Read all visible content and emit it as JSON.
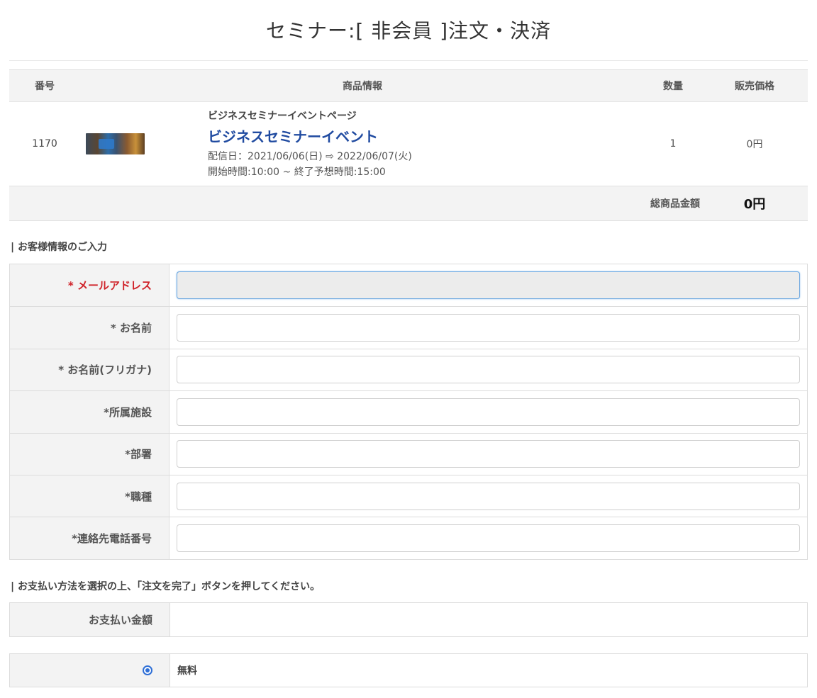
{
  "page": {
    "title": "セミナー:[ 非会員 ]注文・決済"
  },
  "order": {
    "headers": {
      "no": "番号",
      "info": "商品情報",
      "qty": "数量",
      "price": "販売価格"
    },
    "item": {
      "no": "1170",
      "thumbnail_icon": "seminar-photo",
      "sub": "ビジネスセミナーイベントページ",
      "name": "ビジネスセミナーイベント",
      "dates": "配信日：2021/06/06(日) ⇨ 2022/06/07(火)",
      "times": "開始時間:10:00 ~ 終了予想時間:15:00",
      "qty": "1",
      "price": "0円"
    },
    "total": {
      "label": "総商品金額",
      "value": "0円"
    }
  },
  "customer": {
    "heading": "| お客様情報のご入力",
    "fields": [
      {
        "label": "* メールアドレス",
        "value": ""
      },
      {
        "label": "* お名前",
        "value": ""
      },
      {
        "label": "* お名前(フリガナ)",
        "value": ""
      },
      {
        "label": "*所属施設",
        "value": ""
      },
      {
        "label": "*部署",
        "value": ""
      },
      {
        "label": "*職種",
        "value": ""
      },
      {
        "label": "*連絡先電話番号",
        "value": ""
      }
    ]
  },
  "payment": {
    "heading": "| お支払い方法を選択の上、「注文を完了」ボタンを押してください。",
    "amount_label": "お支払い金額",
    "amount_value": "",
    "method_label": "無料",
    "method_selected": true
  },
  "colors": {
    "accent_blue": "#1f4aa0",
    "required_red": "#d0232a",
    "header_bg": "#f3f3f3"
  }
}
